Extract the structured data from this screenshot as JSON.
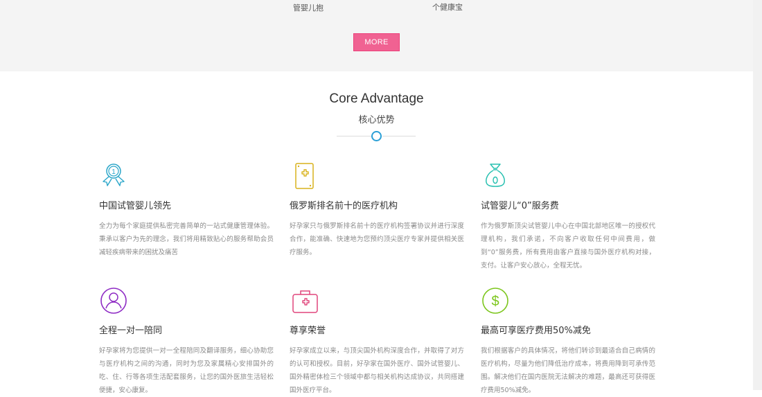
{
  "top_section": {
    "captions": [
      "管婴儿抱",
      "个健康宝"
    ],
    "more_button": "MORE"
  },
  "advantage": {
    "title": "Core Advantage",
    "subtitle": "核心优势",
    "cards": [
      {
        "title": "中国试管婴儿领先",
        "icon": "ribbon-medal-icon",
        "color": "#2aa6c9",
        "desc": "全力为每个家庭提供私密完善简单的一站式健康管理体验。秉承以客户为先的理念，我们将用精致贴心的服务帮助会员减轻疾病带来的困扰及痛苦"
      },
      {
        "title": "俄罗斯排名前十的医疗机构",
        "icon": "medical-card-icon",
        "color": "#d9b21c",
        "desc": "好孕家只与俄罗斯排名前十的医疗机构签署协议并进行深度合作，能准确、快速地为您预约顶尖医疗专家并提供相关医疗服务。"
      },
      {
        "title": "试管婴儿“0”服务费",
        "icon": "money-bag-icon",
        "color": "#27c0b0",
        "desc": "作为俄罗斯顶尖试管婴儿中心在中国北部地区唯一的授权代理机构，我们承诺，不向客户收取任何中间费用，做到“0”服务费，所有费用由客户直接与国外医疗机构对接，支付。让客户安心放心，全程无忧。"
      },
      {
        "title": "全程一对一陪同",
        "icon": "user-circle-icon",
        "color": "#8e2bc4",
        "desc": "好孕家将为您提供一对一全程陪同及翻译服务，细心协助您与医疗机构之间的沟通，同时为您及家属精心安排国外的吃、住、行等各项生活配套服务，让您的国外医旅生活轻松便捷，安心康复。"
      },
      {
        "title": "尊享荣誉",
        "icon": "first-aid-kit-icon",
        "color": "#e0457b",
        "desc": "好孕家成立以来，与顶尖国外机构深度合作，并取得了对方的认可和授权。目前，好孕家在国外医疗、国外试管婴儿、国外精密体检三个领域中都与相关机构达成协议，共同搭建国外医疗平台。"
      },
      {
        "title": "最高可享医疗费用50%减免",
        "icon": "dollar-coin-icon",
        "color": "#7cc61c",
        "desc": "我们根据客户的具体情况，将他们转诊到最适合自己病情的医疗机构，尽量为他们降低治疗成本，将费用降到可承传范围。解决他们在国内医院无法解决的难题，最高还可获得医疗费用50%减免。"
      }
    ]
  }
}
